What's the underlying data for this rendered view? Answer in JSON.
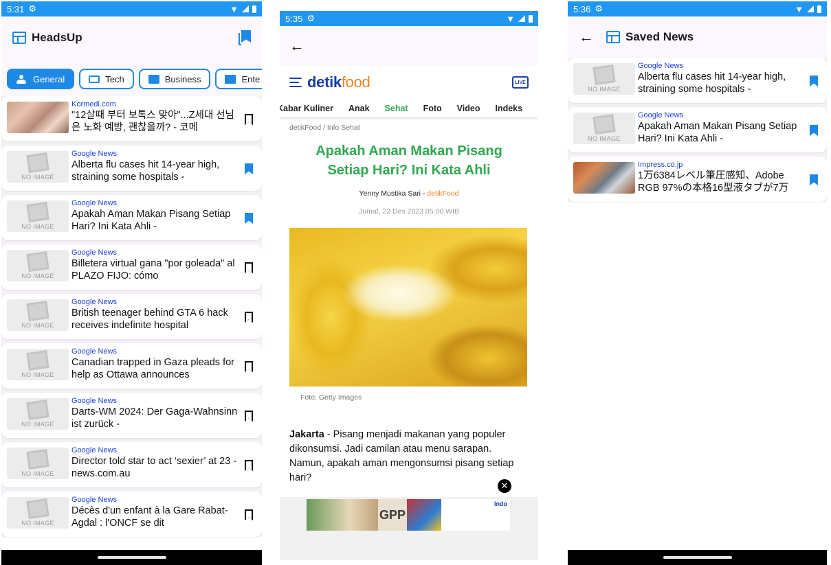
{
  "screen1": {
    "status": {
      "time": "5:31"
    },
    "appbar": {
      "title": "HeadsUp"
    },
    "tabs": [
      {
        "label": "General",
        "icon": "people-icon",
        "active": true
      },
      {
        "label": "Tech",
        "icon": "laptop-icon",
        "active": false
      },
      {
        "label": "Business",
        "icon": "briefcase-icon",
        "active": false
      },
      {
        "label": "Ente",
        "icon": "movie-icon",
        "active": false
      }
    ],
    "articles": [
      {
        "source": "Kormedi.com",
        "title": "\"12살때 부터 보톡스 맞아\"...Z세대 선님은 노화 예방, 괜찮을까? - 코메",
        "image": "photo",
        "saved": false
      },
      {
        "source": "Google News",
        "title": "Alberta flu cases hit 14-year high, straining some hospitals -",
        "image": "none",
        "saved": true
      },
      {
        "source": "Google News",
        "title": "Apakah Aman Makan Pisang Setiap Hari? Ini Kata Ahli -",
        "image": "none",
        "saved": true
      },
      {
        "source": "Google News",
        "title": "Billetera virtual gana \"por goleada\" al PLAZO FIJO: cómo",
        "image": "none",
        "saved": false
      },
      {
        "source": "Google News",
        "title": "British teenager behind GTA 6 hack receives indefinite hospital",
        "image": "none",
        "saved": false
      },
      {
        "source": "Google News",
        "title": "Canadian trapped in Gaza pleads for help as Ottawa announces",
        "image": "none",
        "saved": false
      },
      {
        "source": "Google News",
        "title": "Darts-WM 2024: Der Gaga-Wahnsinn ist zurück -",
        "image": "none",
        "saved": false
      },
      {
        "source": "Google News",
        "title": "Director told star to act ‘sexier’ at 23 - news.com.au",
        "image": "none",
        "saved": false
      },
      {
        "source": "Google News",
        "title": "Décès d'un enfant à la Gare Rabat-Agdal : l'ONCF se dit",
        "image": "none",
        "saved": false
      }
    ],
    "no_image_label": "NO IMAGE"
  },
  "screen2": {
    "status": {
      "time": "5:35"
    },
    "site": {
      "logo_main": "detik",
      "logo_accent": "food",
      "live_label": "LIVE",
      "nav": [
        "Kabar Kuliner",
        "Anak",
        "Sehat",
        "Foto",
        "Video",
        "Indeks"
      ],
      "nav_active": "Sehat"
    },
    "article": {
      "breadcrumb": "detikFood / Info Sehat",
      "headline": "Apakah Aman Makan Pisang Setiap Hari? Ini Kata Ahli",
      "author": "Yenny Mustika Sari",
      "author_sep": " - ",
      "author_source": "detikFood",
      "date": "Jumat, 22 Des 2023 05:00 WIB",
      "photo_caption": "Foto: Getty Images",
      "lead_bold": "Jakarta",
      "lead_text": " - Pisang menjadi makanan yang populer dikonsumsi. Jadi camilan atau menu sarapan. Namun, apakah aman mengonsumsi pisang setiap hari?"
    },
    "ad": {
      "close": "✕",
      "brand": "Indo",
      "mid_text": "GPP"
    }
  },
  "screen3": {
    "status": {
      "time": "5:36"
    },
    "appbar": {
      "title": "Saved News"
    },
    "articles": [
      {
        "source": "Google News",
        "title": "Alberta flu cases hit 14-year high, straining some hospitals -",
        "image": "none"
      },
      {
        "source": "Google News",
        "title": "Apakah Aman Makan Pisang Setiap Hari? Ini Kata Ahli -",
        "image": "none"
      },
      {
        "source": "Impress.co.jp",
        "title": "1万6384レベル筆圧感知、Adobe RGB 97%の本格16型液タブが7万",
        "image": "tablet"
      }
    ]
  },
  "colors": {
    "accent": "#1E88E5",
    "status_bar": "#2196F3",
    "detik_blue": "#1a3fa6",
    "detik_green": "#2fa84f",
    "detik_orange": "#f0821f"
  }
}
